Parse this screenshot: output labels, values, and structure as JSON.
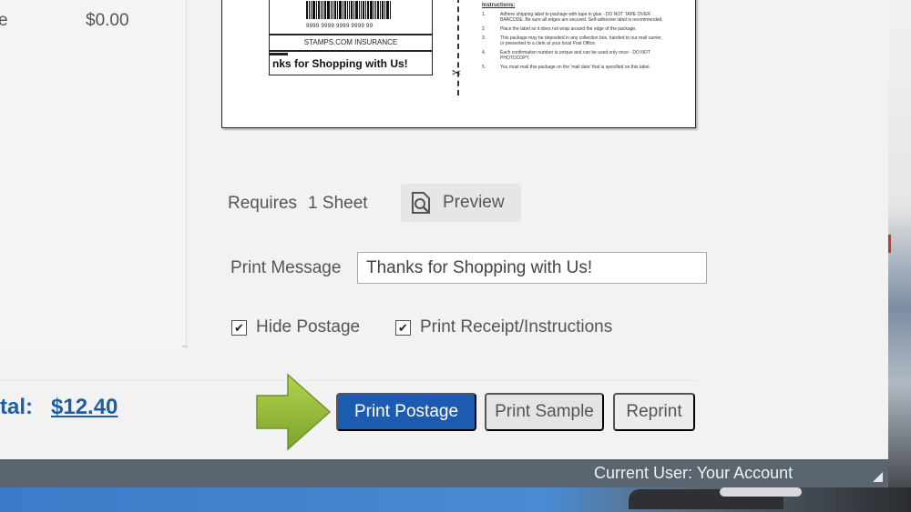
{
  "summary": {
    "partial_label": "e",
    "amount": "$0.00"
  },
  "label": {
    "barcode_digits": "9999 9999 9999 9999 99",
    "insurance_text": "STAMPS.COM INSURANCE",
    "thanks_text": "nks for Shopping with Us!",
    "instructions_title": "Instructions:",
    "instructions": [
      {
        "num": "1.",
        "text": "Adhere shipping label to package with tape in glue - DO NOT TAPE OVER BARCODE. Be sure all edges are secured. Self-adhesive label is recommended."
      },
      {
        "num": "2.",
        "text": "Place the label so it does not wrap around the edge of the package."
      },
      {
        "num": "3.",
        "text": "This package may be deposited in any collection box, handed to our mail carrier, or presented to a clerk at your local Post Office."
      },
      {
        "num": "4.",
        "text": "Each confirmation number is unique and can be used only once - DO NOT PHOTOCOPY."
      },
      {
        "num": "5.",
        "text": "You must mail this package on the 'mail date' that is specified on this label."
      }
    ]
  },
  "requires": {
    "label": "Requires",
    "count": "1 Sheet"
  },
  "preview_button": {
    "label": "Preview"
  },
  "print_message": {
    "label": "Print Message",
    "value": "Thanks for Shopping with Us!"
  },
  "options": {
    "hide_postage": {
      "label": "Hide Postage",
      "checked": true
    },
    "print_receipt": {
      "label": "Print Receipt/Instructions",
      "checked": true
    }
  },
  "total": {
    "label": "tal:",
    "amount": "$12.40"
  },
  "actions": {
    "print_postage": "Print Postage",
    "print_sample": "Print Sample",
    "reprint": "Reprint"
  },
  "status_bar": {
    "current_user": "Current User: Your Account"
  },
  "colors": {
    "primary_button": "#1b5cb0",
    "total_text": "#1a5fa8",
    "arrow": "#8fb83a",
    "status_bar": "#5b6570"
  }
}
